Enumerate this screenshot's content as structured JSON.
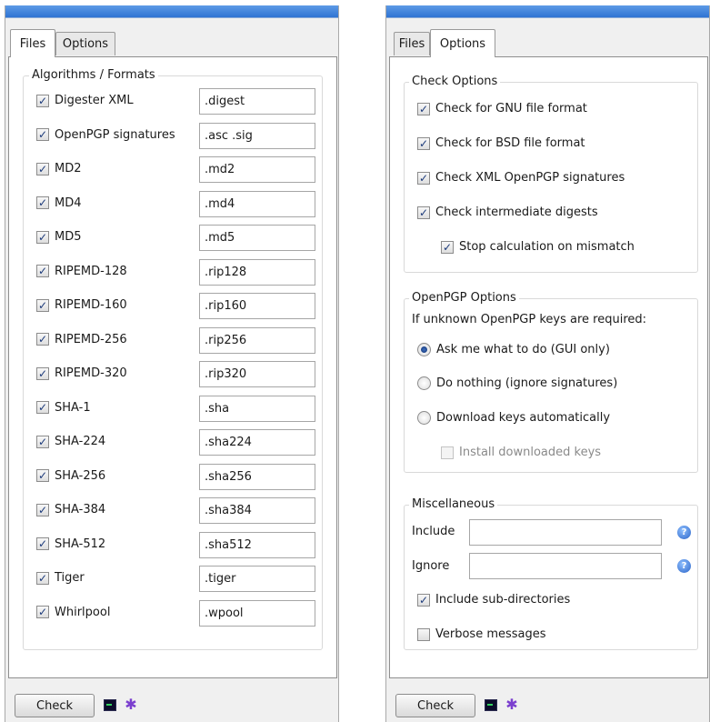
{
  "files_window": {
    "tabs": [
      {
        "label": "Files",
        "active": true
      },
      {
        "label": "Options",
        "active": false
      }
    ],
    "group_title": "Algorithms / Formats",
    "algorithms": [
      {
        "label": "Digester XML",
        "checked": true,
        "extension": ".digest"
      },
      {
        "label": "OpenPGP signatures",
        "checked": true,
        "extension": ".asc .sig"
      },
      {
        "label": "MD2",
        "checked": true,
        "extension": ".md2"
      },
      {
        "label": "MD4",
        "checked": true,
        "extension": ".md4"
      },
      {
        "label": "MD5",
        "checked": true,
        "extension": ".md5"
      },
      {
        "label": "RIPEMD-128",
        "checked": true,
        "extension": ".rip128"
      },
      {
        "label": "RIPEMD-160",
        "checked": true,
        "extension": ".rip160"
      },
      {
        "label": "RIPEMD-256",
        "checked": true,
        "extension": ".rip256"
      },
      {
        "label": "RIPEMD-320",
        "checked": true,
        "extension": ".rip320"
      },
      {
        "label": "SHA-1",
        "checked": true,
        "extension": ".sha"
      },
      {
        "label": "SHA-224",
        "checked": true,
        "extension": ".sha224"
      },
      {
        "label": "SHA-256",
        "checked": true,
        "extension": ".sha256"
      },
      {
        "label": "SHA-384",
        "checked": true,
        "extension": ".sha384"
      },
      {
        "label": "SHA-512",
        "checked": true,
        "extension": ".sha512"
      },
      {
        "label": "Tiger",
        "checked": true,
        "extension": ".tiger"
      },
      {
        "label": "Whirlpool",
        "checked": true,
        "extension": ".wpool"
      }
    ],
    "check_button": "Check"
  },
  "options_window": {
    "tabs": [
      {
        "label": "Files",
        "active": false
      },
      {
        "label": "Options",
        "active": true
      }
    ],
    "check_options": {
      "title": "Check Options",
      "items": [
        {
          "label": "Check for GNU file format",
          "checked": true
        },
        {
          "label": "Check for BSD file format",
          "checked": true
        },
        {
          "label": "Check XML OpenPGP signatures",
          "checked": true
        },
        {
          "label": "Check intermediate digests",
          "checked": true
        },
        {
          "label": "Stop calculation on mismatch",
          "checked": true
        }
      ]
    },
    "openpgp_options": {
      "title": "OpenPGP Options",
      "prompt": "If unknown OpenPGP keys are required:",
      "radios": [
        {
          "label": "Ask me what to do (GUI only)",
          "selected": true
        },
        {
          "label": "Do nothing (ignore signatures)",
          "selected": false
        },
        {
          "label": "Download keys automatically",
          "selected": false
        }
      ],
      "install_keys": {
        "label": "Install downloaded keys",
        "checked": false,
        "enabled": false
      }
    },
    "miscellaneous": {
      "title": "Miscellaneous",
      "include_label": "Include",
      "include_value": "",
      "ignore_label": "Ignore",
      "ignore_value": "",
      "include_subdirs": {
        "label": "Include sub-directories",
        "checked": true
      },
      "verbose": {
        "label": "Verbose messages",
        "checked": false
      }
    },
    "check_button": "Check"
  },
  "icons": {
    "checkmark": "✓",
    "help": "?",
    "bug": "✱"
  }
}
